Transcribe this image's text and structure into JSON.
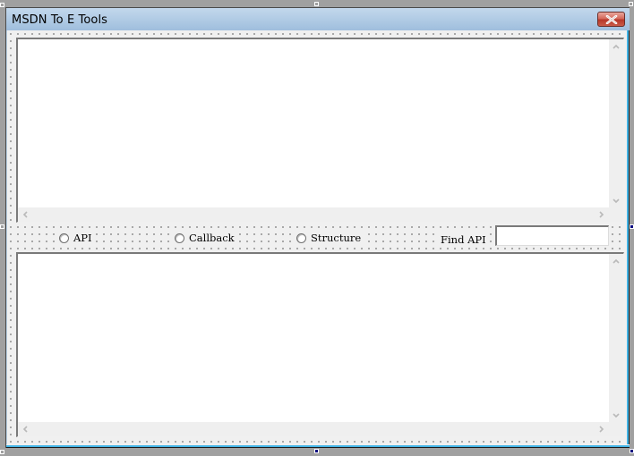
{
  "window": {
    "title": "MSDN To E Tools",
    "close_label": "Close"
  },
  "icons": {
    "close": "close-icon",
    "scroll_up": "chevron-up-icon",
    "scroll_down": "chevron-down-icon",
    "scroll_left": "chevron-left-icon",
    "scroll_right": "chevron-right-icon"
  },
  "options": {
    "radios": [
      {
        "label": "API",
        "checked": false
      },
      {
        "label": "Callback",
        "checked": false
      },
      {
        "label": "Structure",
        "checked": false
      }
    ],
    "find_label": "Find API",
    "find_value": "",
    "find_placeholder": ""
  },
  "lists": {
    "top_items": [],
    "bottom_items": []
  },
  "colors": {
    "designer_background": "#a0a0a0",
    "client_background": "#f0f0f0",
    "titlebar_top": "#c3d8ec",
    "titlebar_bottom": "#9fbedd",
    "close_button": "#c95a48",
    "selection_handle": "#000080",
    "window_border_accent": "#42b4e6"
  }
}
